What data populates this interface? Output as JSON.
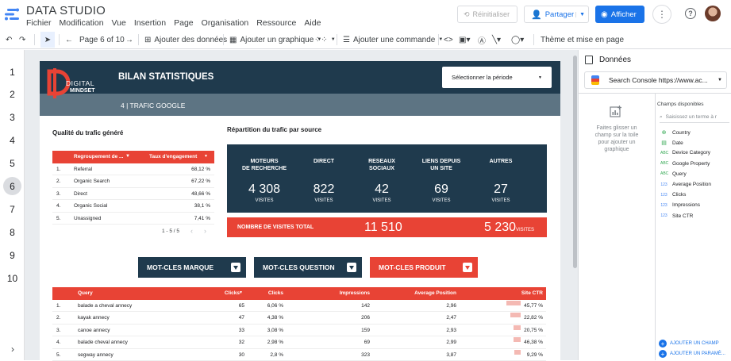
{
  "app": {
    "title": "DATA STUDIO",
    "menu": [
      "Fichier",
      "Modification",
      "Vue",
      "Insertion",
      "Page",
      "Organisation",
      "Ressource",
      "Aide"
    ]
  },
  "header": {
    "reset_label": "Réinitialiser",
    "share_label": "Partager",
    "view_label": "Afficher"
  },
  "toolbar": {
    "page_indicator": "Page 6 of 10",
    "add_data": "Ajouter des données",
    "add_chart": "Ajouter un graphique",
    "add_control": "Ajouter une commande",
    "theme": "Thème et mise en page"
  },
  "pages": [
    "1",
    "2",
    "3",
    "4",
    "5",
    "6",
    "7",
    "8",
    "9",
    "10"
  ],
  "report": {
    "logo_top": "DIGITAL",
    "logo_bottom": "MINDSET",
    "title": "BILAN STATISTIQUES",
    "subtitle": "4 | TRAFIC GOOGLE",
    "period_select": "Sélectionner la période",
    "quality_title": "Qualité du trafic généré",
    "quality_headers": [
      "Regroupement de ...",
      "Taux d'engagement"
    ],
    "quality_rows": [
      [
        "1.",
        "Referral",
        "68,12 %"
      ],
      [
        "2.",
        "Organic Search",
        "67,22 %"
      ],
      [
        "3.",
        "Direct",
        "48,66 %"
      ],
      [
        "4.",
        "Organic Social",
        "38,1 %"
      ],
      [
        "5.",
        "Unassigned",
        "7,41 %"
      ]
    ],
    "quality_pager": "1 - 5 / 5",
    "split_title": "Répartition du trafic par source",
    "sources": [
      {
        "label": "MOTEURS\nDE RECHERCHE",
        "value": "4 308",
        "unit": "VISITES"
      },
      {
        "label": "DIRECT",
        "value": "822",
        "unit": "VISITES"
      },
      {
        "label": "RESEAUX\nSOCIAUX",
        "value": "42",
        "unit": "VISITES"
      },
      {
        "label": "LIENS DEPUIS\nUN SITE",
        "value": "69",
        "unit": "VISITES"
      },
      {
        "label": "AUTRES",
        "value": "27",
        "unit": "VISITES"
      }
    ],
    "total_label": "NOMBRE DE VISITES TOTAL",
    "total_value": "11 510",
    "total_value2": "5 230",
    "total_unit": "VISITES",
    "keyword_buttons": [
      "MOT-CLES MARQUE",
      "MOT-CLES QUESTION",
      "MOT-CLES PRODUIT"
    ],
    "query_headers": [
      "Query",
      "Clicks",
      "Clicks",
      "Impressions",
      "Average Position",
      "Site CTR"
    ],
    "query_rows": [
      [
        "1.",
        "balade a cheval annecy",
        "65",
        "6,06 %",
        "142",
        "2,96",
        "45,77 %"
      ],
      [
        "2.",
        "kayak annecy",
        "47",
        "4,38 %",
        "206",
        "2,47",
        "22,82 %"
      ],
      [
        "3.",
        "canoe annecy",
        "33",
        "3,08 %",
        "159",
        "2,93",
        "20,75 %"
      ],
      [
        "4.",
        "balade cheval annecy",
        "32",
        "2,98 %",
        "69",
        "2,99",
        "46,38 %"
      ],
      [
        "5.",
        "segway annecy",
        "30",
        "2,8 %",
        "323",
        "3,87",
        "9,29 %"
      ]
    ]
  },
  "panel": {
    "title": "Données",
    "source": "Search Console https://www.ac...",
    "hint": "Faites glisser un champ sur la toile pour ajouter un graphique",
    "fields_title": "Champs disponibles",
    "search_placeholder": "Saisissez un terme à r",
    "fields": [
      [
        "geo",
        "Country"
      ],
      [
        "date",
        "Date"
      ],
      [
        "ABC",
        "Device Category"
      ],
      [
        "ABC",
        "Google Property"
      ],
      [
        "ABC",
        "Query"
      ],
      [
        "123",
        "Average Position"
      ],
      [
        "123",
        "Clicks"
      ],
      [
        "123",
        "Impressions"
      ],
      [
        "123",
        "Site CTR"
      ]
    ],
    "add_field": "AJOUTER UN CHAMP",
    "add_param": "AJOUTER UN PARAMÈ..."
  },
  "colors": {
    "accent": "#1a73e8",
    "navy": "#1f3a4d",
    "red": "#e84335",
    "slate": "#5d7483"
  }
}
